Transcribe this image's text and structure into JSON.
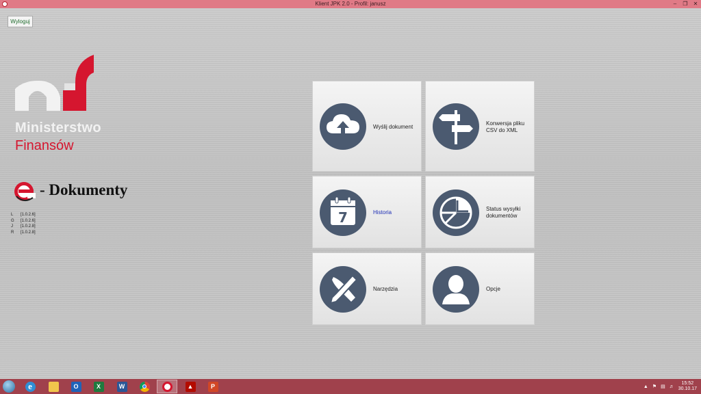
{
  "window": {
    "title": "Klient JPK 2.0 - Profil: janusz",
    "controls": [
      "minimize-icon",
      "restore-icon",
      "close-icon"
    ]
  },
  "toolbar": {
    "logout_label": "Wyloguj"
  },
  "ministry": {
    "line1": "Ministerstwo",
    "line2": "Finansów",
    "brand_red": "#d5162f"
  },
  "product": {
    "title": "- Dokumenty"
  },
  "versions": [
    {
      "key": "L",
      "value": "[1.0.2.6]"
    },
    {
      "key": "G",
      "value": "[1.0.2.6]"
    },
    {
      "key": "J",
      "value": "[1.0.2.8]"
    },
    {
      "key": "R",
      "value": "[1.0.2.8]"
    }
  ],
  "tiles": {
    "send": {
      "label": "Wyślij dokument",
      "icon": "cloud-upload-icon"
    },
    "convert": {
      "label_line1": "Konwersja pliku",
      "label_line2": "CSV do XML",
      "icon": "signpost-icon"
    },
    "history": {
      "label": "Historia",
      "icon": "calendar-icon",
      "day": "7"
    },
    "status": {
      "label_line1": "Status wysyłki",
      "label_line2": "dokumentów",
      "icon": "pie-chart-icon"
    },
    "tools": {
      "label": "Narzędzia",
      "icon": "tools-icon"
    },
    "options": {
      "label": "Opcje",
      "icon": "user-icon"
    }
  },
  "taskbar": {
    "apps": [
      "internet-explorer-icon",
      "file-explorer-icon",
      "outlook-icon",
      "excel-icon",
      "word-icon",
      "chrome-icon",
      "e-dokumenty-icon",
      "acrobat-icon",
      "powerpoint-icon"
    ],
    "app_letters": {
      "outlook": "O",
      "excel": "X",
      "word": "W",
      "powerpoint": "P"
    },
    "clock_time": "15:52",
    "clock_date": "30.10.17"
  },
  "colors": {
    "titlebar": "#e07a86",
    "taskbar": "#a0414c",
    "tile_circle": "#4b5a70"
  }
}
